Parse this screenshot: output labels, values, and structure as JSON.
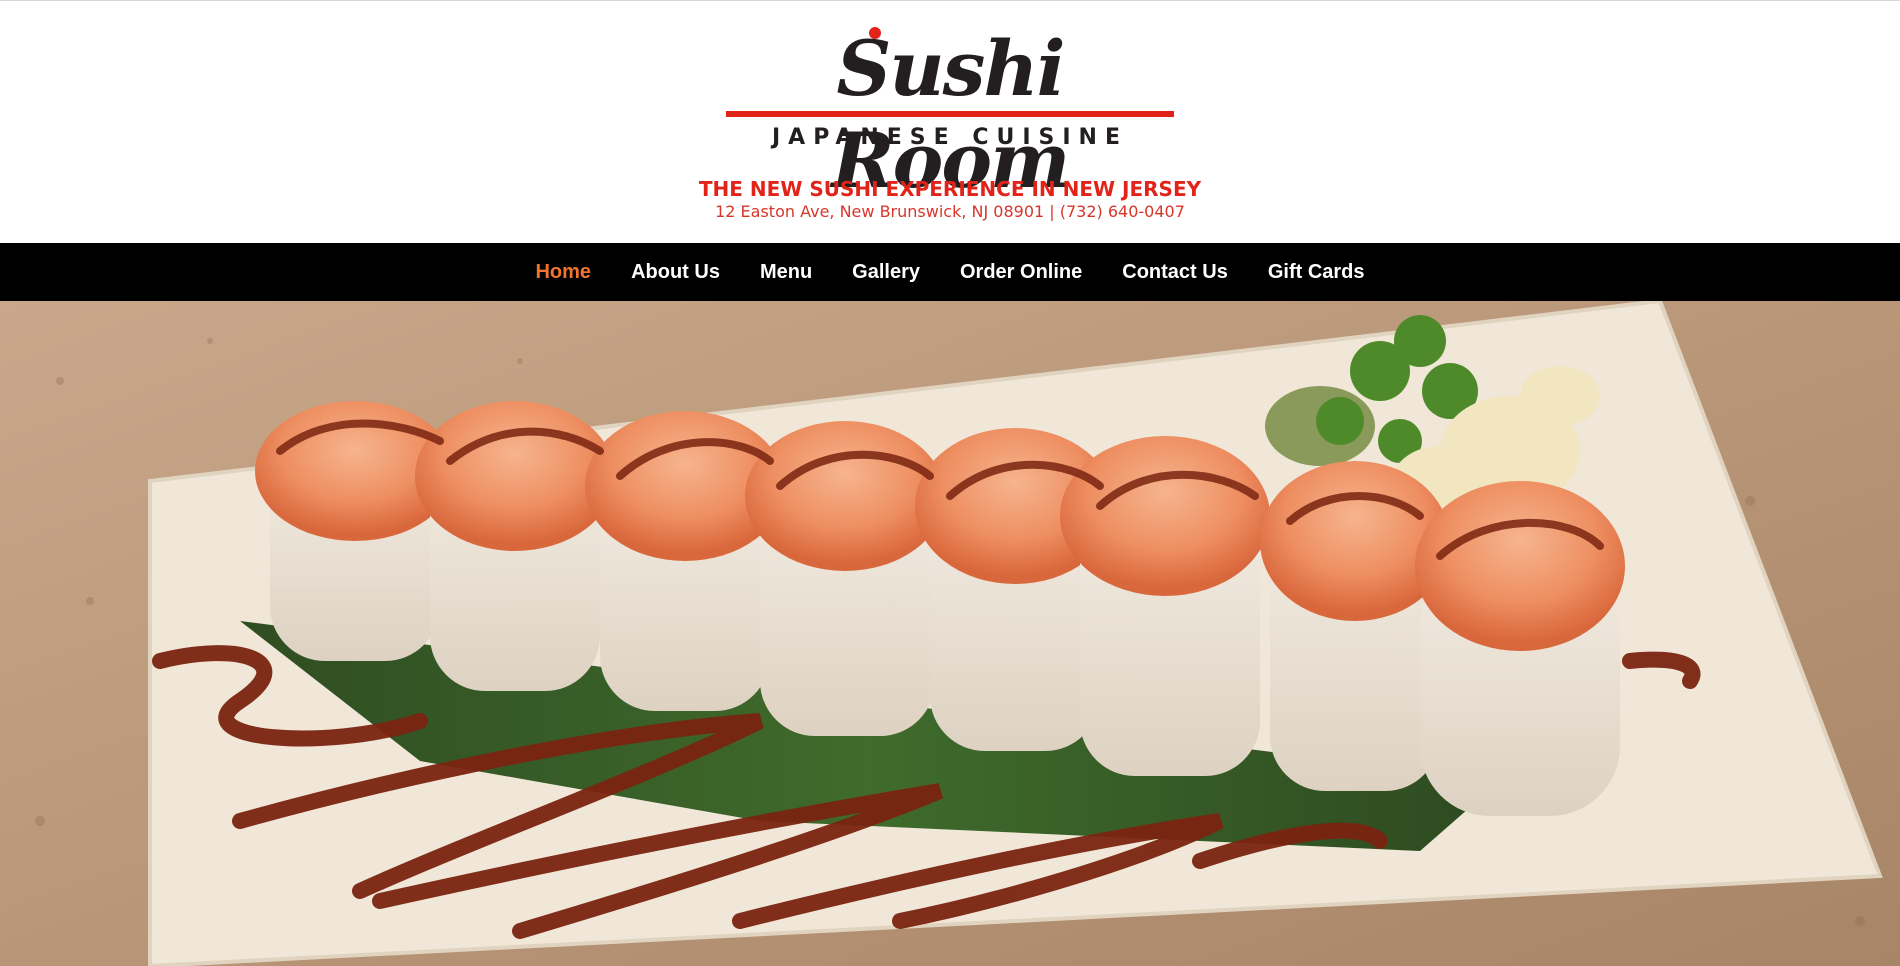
{
  "header": {
    "logo": {
      "name": "Sushi Room",
      "subtitle": "JAPANESE CUISINE"
    },
    "tagline": "THE NEW SUSHI EXPERIENCE IN NEW JERSEY",
    "address": "12 Easton Ave, New Brunswick, NJ 08901 | (732) 640-0407"
  },
  "nav": {
    "items": [
      {
        "label": "Home",
        "active": true
      },
      {
        "label": "About Us",
        "active": false
      },
      {
        "label": "Menu",
        "active": false
      },
      {
        "label": "Gallery",
        "active": false
      },
      {
        "label": "Order Online",
        "active": false
      },
      {
        "label": "Contact Us",
        "active": false
      },
      {
        "label": "Gift Cards",
        "active": false
      }
    ]
  },
  "colors": {
    "brand_red": "#e2231a",
    "nav_background": "#000000",
    "nav_active": "#f0742f",
    "nav_text": "#ffffff"
  },
  "hero": {
    "image_subject": "sushi-roll-plate-photo"
  }
}
